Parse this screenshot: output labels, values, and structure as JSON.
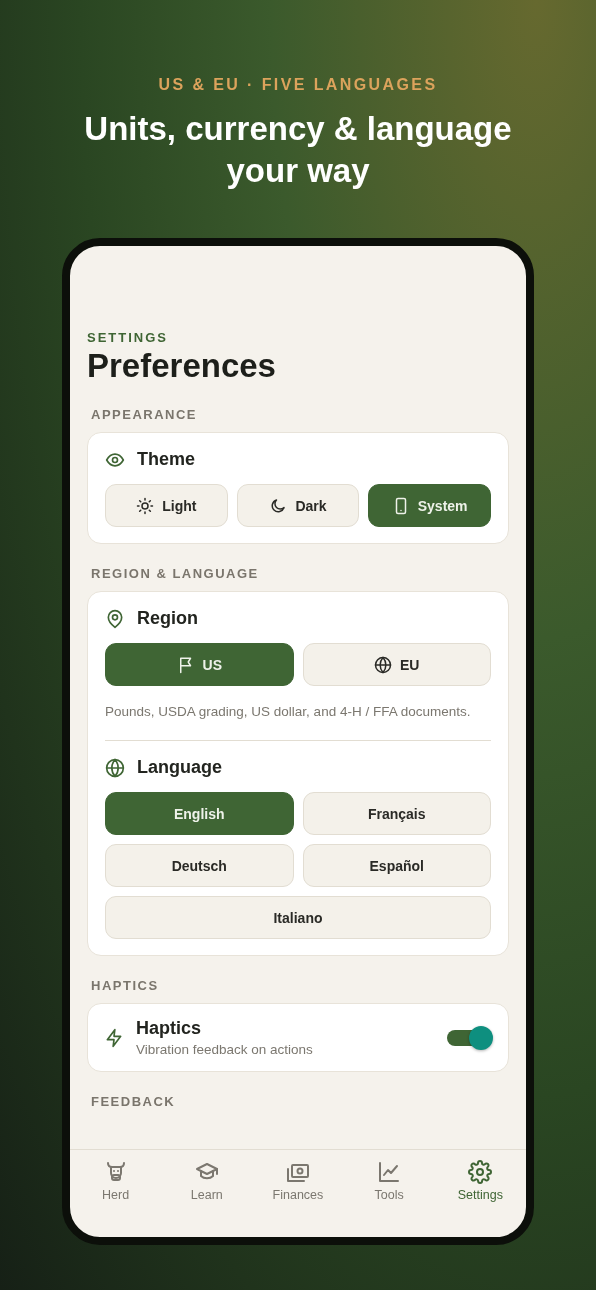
{
  "header": {
    "eyebrow": "US & EU · FIVE LANGUAGES",
    "title": "Units, currency & language your way"
  },
  "screen": {
    "eyebrow": "SETTINGS",
    "title": "Preferences",
    "appearance": {
      "heading": "APPEARANCE",
      "theme": {
        "title": "Theme",
        "options": [
          {
            "label": "Light",
            "selected": false
          },
          {
            "label": "Dark",
            "selected": false
          },
          {
            "label": "System",
            "selected": true
          }
        ]
      }
    },
    "region_language": {
      "heading": "REGION & LANGUAGE",
      "region": {
        "title": "Region",
        "options": [
          {
            "label": "US",
            "selected": true
          },
          {
            "label": "EU",
            "selected": false
          }
        ],
        "note": "Pounds, USDA grading, US dollar, and 4-H / FFA documents."
      },
      "language": {
        "title": "Language",
        "options": [
          {
            "label": "English",
            "selected": true
          },
          {
            "label": "Français",
            "selected": false
          },
          {
            "label": "Deutsch",
            "selected": false
          },
          {
            "label": "Español",
            "selected": false
          },
          {
            "label": "Italiano",
            "selected": false
          }
        ]
      }
    },
    "haptics": {
      "heading": "HAPTICS",
      "title": "Haptics",
      "subtitle": "Vibration feedback on actions",
      "on": true
    },
    "feedback": {
      "heading": "FEEDBACK"
    },
    "tab_bar": [
      {
        "label": "Herd",
        "selected": false
      },
      {
        "label": "Learn",
        "selected": false
      },
      {
        "label": "Finances",
        "selected": false
      },
      {
        "label": "Tools",
        "selected": false
      },
      {
        "label": "Settings",
        "selected": true
      }
    ]
  }
}
